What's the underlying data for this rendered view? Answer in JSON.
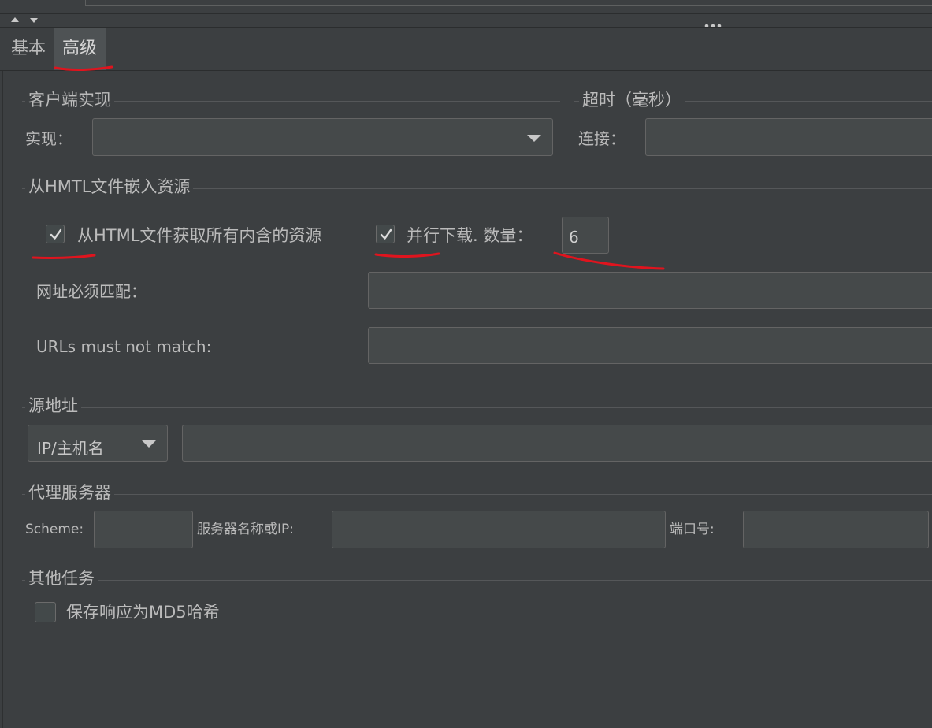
{
  "tabs": [
    {
      "label": "基本"
    },
    {
      "label": "高级"
    }
  ],
  "client_impl": {
    "title": "客户端实现",
    "impl_label": "实现：",
    "impl_value": ""
  },
  "timeout": {
    "title": "超时（毫秒）",
    "connect_label": "连接：",
    "connect_value": ""
  },
  "embedded": {
    "title": "从HMTL文件嵌入资源",
    "retrieve_all_label": "从HTML文件获取所有内含的资源",
    "retrieve_all_checked": true,
    "parallel_label": "并行下载. 数量：",
    "parallel_checked": true,
    "parallel_count": "6",
    "urls_must_match_label": "网址必须匹配：",
    "urls_must_match_value": "",
    "urls_must_not_match_label": "URLs must not match:",
    "urls_must_not_match_value": ""
  },
  "source": {
    "title": "源地址",
    "type_value": "IP/主机名",
    "address_value": ""
  },
  "proxy": {
    "title": "代理服务器",
    "scheme_label": "Scheme:",
    "scheme_value": "",
    "server_label": "服务器名称或IP:",
    "server_value": "",
    "port_label": "端口号:",
    "port_value": ""
  },
  "other": {
    "title": "其他任务",
    "md5_label": "保存响应为MD5哈希",
    "md5_checked": false
  },
  "colors": {
    "background": "#3c3f41",
    "field": "#45494a",
    "annotation": "#e0141e"
  }
}
